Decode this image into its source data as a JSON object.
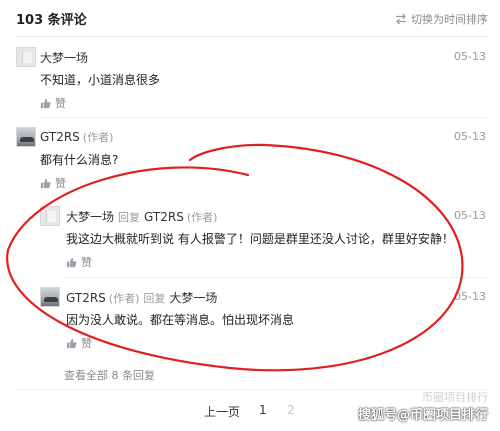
{
  "header": {
    "count_title": "103 条评论",
    "sort_label": "切换为时间排序"
  },
  "comments": [
    {
      "name": "大梦一场",
      "text": "不知道，小道消息很多",
      "date": "05-13",
      "like": "赞"
    },
    {
      "name": "GT2RS",
      "author_tag": "(作者)",
      "text": "都有什么消息?",
      "date": "05-13",
      "like": "赞"
    }
  ],
  "replies": [
    {
      "name": "大梦一场",
      "reply_word": "回复",
      "target": "GT2RS",
      "target_tag": "(作者)",
      "text": "我这边大概就听到说 有人报警了！问题是群里还没人讨论，群里好安静！",
      "date": "05-13",
      "like": "赞"
    },
    {
      "name": "GT2RS",
      "author_tag": "(作者)",
      "reply_word": "回复",
      "target": "大梦一场",
      "text": "因为没人敢说。都在等消息。怕出现坏消息",
      "date": "05-13",
      "like": "赞"
    }
  ],
  "see_all": "查看全部 8 条回复",
  "pagination": {
    "prev": "上一页",
    "page1": "1",
    "page2": "2"
  },
  "watermark": {
    "line1": "币圈项目排行",
    "line2": "搜狐号@币圈项目排行"
  },
  "colors": {
    "annotation_circle": "#e02020",
    "muted_text": "#9a9a9a"
  },
  "icons": {
    "sort": "swap-icon",
    "like": "thumbs-up-icon"
  }
}
